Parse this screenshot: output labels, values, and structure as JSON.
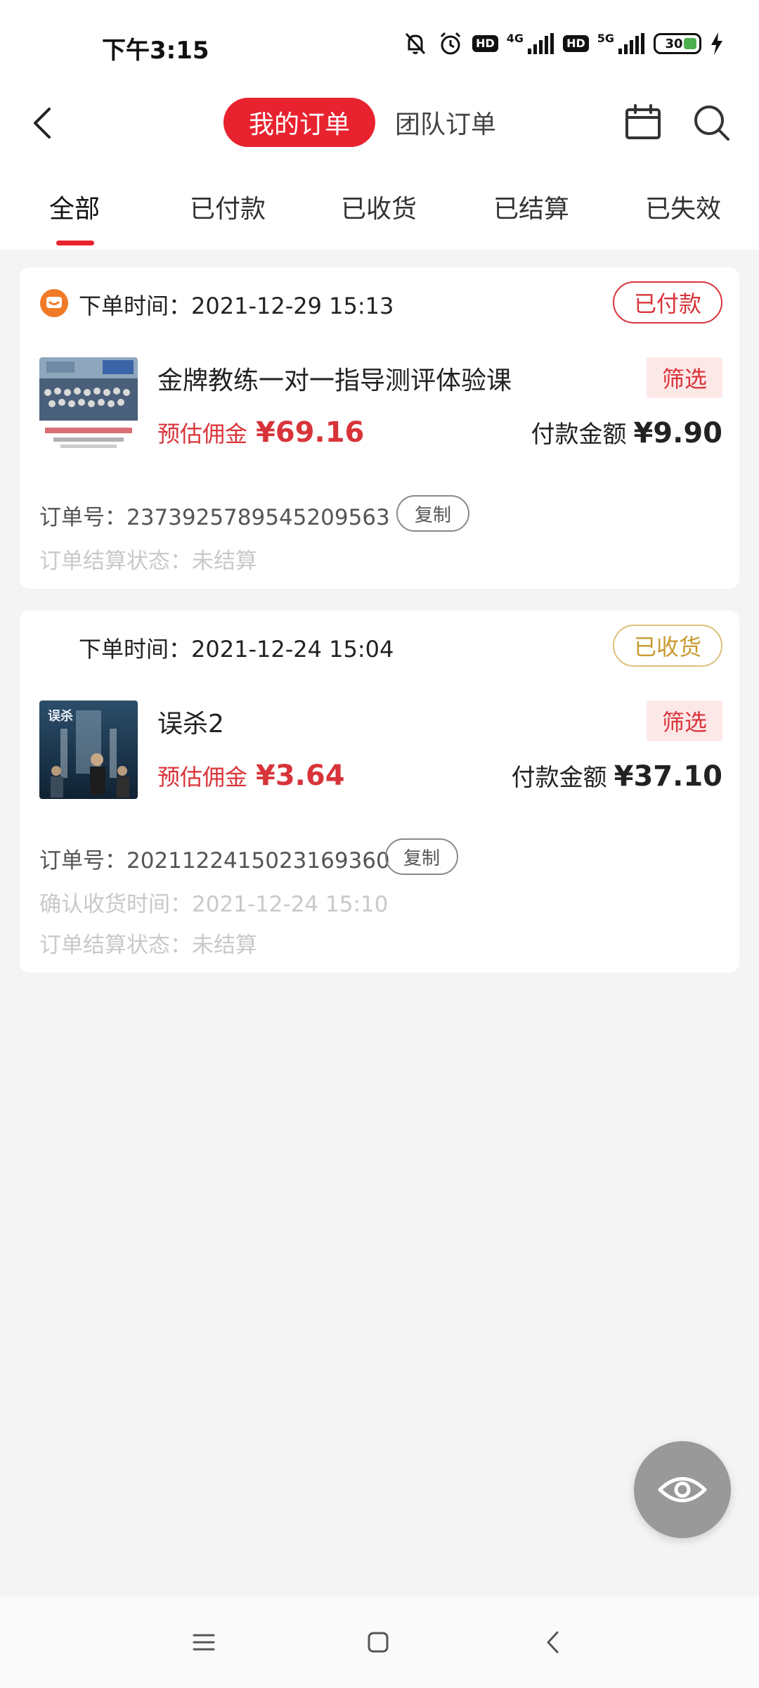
{
  "status_bar": {
    "time": "下午3:15",
    "hd1": "HD",
    "net1": "4G",
    "hd2": "HD",
    "net2": "5G",
    "battery": "30"
  },
  "nav": {
    "tab_my_orders": "我的订单",
    "tab_team_orders": "团队订单"
  },
  "filter_tabs": [
    "全部",
    "已付款",
    "已收货",
    "已结算",
    "已失效"
  ],
  "orders": [
    {
      "order_time_label": "下单时间：",
      "order_time": "2021-12-29 15:13",
      "status": "已付款",
      "title": "金牌教练一对一指导测评体验课",
      "filter_tag": "筛选",
      "commission_label": "预估佣金",
      "commission": "¥69.16",
      "payment_label": "付款金额",
      "payment": "¥9.90",
      "order_no_label": "订单号：",
      "order_no": "2373925789545209563",
      "copy_label": "复制",
      "settle_status_label": "订单结算状态：",
      "settle_status": "未结算",
      "thumb_caption": "金牌教练一对一测评体验课 9.9元"
    },
    {
      "order_time_label": "下单时间：",
      "order_time": "2021-12-24 15:04",
      "status": "已收货",
      "title": "误杀2",
      "filter_tag": "筛选",
      "commission_label": "预估佣金",
      "commission": "¥3.64",
      "payment_label": "付款金额",
      "payment": "¥37.10",
      "order_no_label": "订单号：",
      "order_no": "2021122415023169360",
      "copy_label": "复制",
      "confirm_time_label": "确认收货时间：",
      "confirm_time": "2021-12-24 15:10",
      "settle_status_label": "订单结算状态：",
      "settle_status": "未结算",
      "thumb_caption": "误杀"
    }
  ],
  "colors": {
    "accent_red": "#e8232f",
    "price_red": "#d8343a",
    "received_gold": "#c99a2e",
    "background": "#f4f4f4"
  },
  "icons": {
    "back": "chevron-left-icon",
    "calendar": "calendar-icon",
    "search": "search-icon",
    "eye": "eye-icon",
    "shop": "shop-face-icon"
  }
}
